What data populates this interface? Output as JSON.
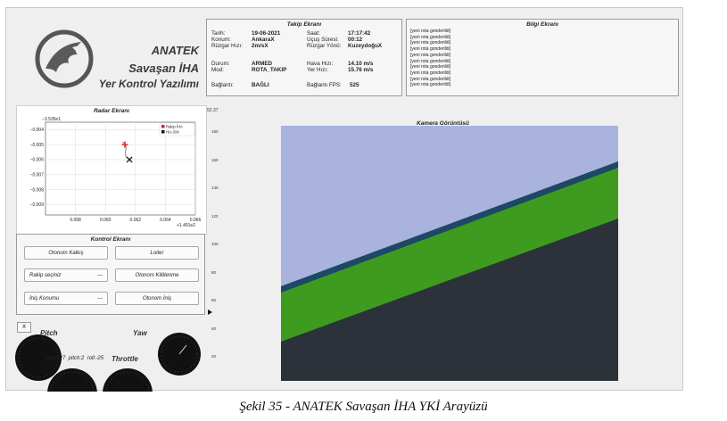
{
  "brand": {
    "title": "ANATEK",
    "subtitle": "Savaşan İHA",
    "tagline": "Yer Kontrol Yazılımı"
  },
  "takip": {
    "title": "Takip Ekranı",
    "tarih_label": "Tarih:",
    "tarih": "19-06-2021",
    "saat_label": "Saat:",
    "saat": "17:17:42",
    "konum_label": "Konum:",
    "konum": "AnkaraX",
    "ucus_label": "Uçuş Süresi:",
    "ucus": "00:12",
    "ruzgar_label": "Rüzgar Hızı:",
    "ruzgar": "2m/sX",
    "ruzgar_yonu_label": "Rüzgar Yönü:",
    "ruzgar_yonu": "KuzeydoğuX",
    "durum_label": "Durum:",
    "durum": "ARMED",
    "hava_label": "Hava Hızı:",
    "hava": "14.10 m/s",
    "mod_label": "Mod:",
    "mod": "ROTA_TAKIP",
    "yer_label": "Yer Hızı:",
    "yer": "15.76 m/s",
    "baglanti_label": "Bağlantı:",
    "baglanti": "BAĞLI",
    "fps_label": "Bağlantı FPS:",
    "fps": "525"
  },
  "bilgi": {
    "title": "Bilgi Ekranı",
    "lines": [
      "[yeni rota gonderildi]",
      "[yeni rota gonderildi]",
      "[yeni rota gonderildi]",
      "[yeni rota gonderildi]",
      "[yeni rota gonderildi]",
      "[yeni rota gonderildi]",
      "[yeni rota gonderildi]",
      "[yeni rota gonderildi]",
      "[yeni rota gonderildi]",
      "[yeni rota gonderildi]"
    ]
  },
  "radar": {
    "title": "Radar Ekranı",
    "y_offset": "−3.535e1",
    "x_offset": "+1.491e2",
    "legend": [
      {
        "name": "Rakip İHA",
        "color": "#e0192b"
      },
      {
        "name": "HU-33X",
        "color": "#111111"
      }
    ]
  },
  "chart_data": {
    "type": "scatter",
    "title": "Radar Ekranı",
    "x_ticks": [
      "0.058",
      "0.060",
      "0.062",
      "0.064",
      "0.066"
    ],
    "y_ticks": [
      "−0.004",
      "−0.005",
      "−0.006",
      "−0.007",
      "−0.008",
      "−0.009"
    ],
    "xlim": [
      0.056,
      0.066
    ],
    "ylim": [
      -0.0097,
      -0.0035
    ],
    "series": [
      {
        "name": "Rakip İHA",
        "points": [
          [
            0.0613,
            -0.005
          ]
        ],
        "color": "#e0192b"
      },
      {
        "name": "HU-33X",
        "points": [
          [
            0.0616,
            -0.006
          ]
        ],
        "color": "#111111"
      }
    ],
    "grid": true,
    "legend_position": "top-right"
  },
  "kontrol": {
    "title": "Kontrol Ekranı",
    "otonom_kalkis": "Otonom Kalkış",
    "loiter": "Loiter",
    "rakip_sec": "Rakip seçiniz",
    "otonom_kilitlenme": "Otonom Kilitlenme",
    "inis_konumu": "İniş Konumu",
    "otonom_inis": "Otonom İniş",
    "dash": "---"
  },
  "gauges": {
    "close": "X",
    "pitch": "Pitch",
    "yaw": "Yaw",
    "throttle": "Throttle",
    "readout": "yaw:127  pitch:2  roll:-25"
  },
  "camera": {
    "title": "Kamera Görüntüsü",
    "scale_top": "52.37",
    "ticks": [
      "180",
      "160",
      "140",
      "120",
      "100",
      "80",
      "60",
      "40",
      "20"
    ],
    "colors": {
      "sky": "#a9b3de",
      "grass": "#3f9b1f",
      "road": "#2b3239",
      "edge": "#1d4866"
    }
  },
  "caption": "Şekil 35 - ANATEK Savaşan İHA YKİ Arayüzü"
}
